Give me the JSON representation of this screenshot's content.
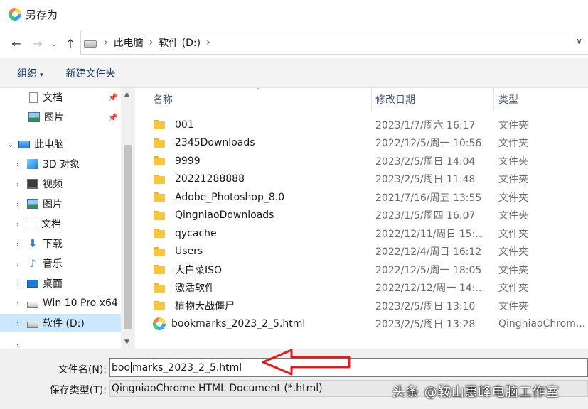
{
  "window": {
    "title": "另存为"
  },
  "address": {
    "crumbs": [
      "此电脑",
      "软件 (D:)"
    ]
  },
  "toolbar": {
    "organize": "组织",
    "new_folder": "新建文件夹"
  },
  "sidebar": {
    "items": [
      {
        "label": "文档",
        "icon": "document-icon",
        "pinned": true
      },
      {
        "label": "图片",
        "icon": "picture-icon",
        "pinned": true
      },
      {
        "label": "此电脑",
        "icon": "computer-icon",
        "expanded": true
      },
      {
        "label": "3D 对象",
        "icon": "3d-objects-icon"
      },
      {
        "label": "视频",
        "icon": "video-icon"
      },
      {
        "label": "图片",
        "icon": "picture-icon"
      },
      {
        "label": "文档",
        "icon": "document-icon"
      },
      {
        "label": "下载",
        "icon": "download-icon"
      },
      {
        "label": "音乐",
        "icon": "music-icon"
      },
      {
        "label": "桌面",
        "icon": "desktop-icon"
      },
      {
        "label": "Win 10 Pro x64",
        "icon": "windows-drive-icon"
      },
      {
        "label": "软件 (D:)",
        "icon": "drive-icon",
        "selected": true
      }
    ]
  },
  "columns": {
    "name": "名称",
    "date": "修改日期",
    "type": "类型"
  },
  "files": [
    {
      "name": "001",
      "date": "2023/1/7/周六 16:17",
      "type": "文件夹",
      "kind": "folder"
    },
    {
      "name": "2345Downloads",
      "date": "2022/12/5/周一 10:56",
      "type": "文件夹",
      "kind": "folder"
    },
    {
      "name": "9999",
      "date": "2023/2/5/周日 14:04",
      "type": "文件夹",
      "kind": "folder"
    },
    {
      "name": "20221288888",
      "date": "2023/2/5/周日 11:48",
      "type": "文件夹",
      "kind": "folder"
    },
    {
      "name": "Adobe_Photoshop_8.0",
      "date": "2021/7/16/周五 13:55",
      "type": "文件夹",
      "kind": "folder"
    },
    {
      "name": "QingniaoDownloads",
      "date": "2023/1/5/周四 16:07",
      "type": "文件夹",
      "kind": "folder"
    },
    {
      "name": "qycache",
      "date": "2022/12/11/周日 15:...",
      "type": "文件夹",
      "kind": "folder"
    },
    {
      "name": "Users",
      "date": "2022/12/4/周日 16:12",
      "type": "文件夹",
      "kind": "folder"
    },
    {
      "name": "大白菜ISO",
      "date": "2022/12/5/周一 18:05",
      "type": "文件夹",
      "kind": "folder"
    },
    {
      "name": "激活软件",
      "date": "2022/12/12/周一 14:...",
      "type": "文件夹",
      "kind": "folder"
    },
    {
      "name": "植物大战僵尸",
      "date": "2023/2/5/周日 13:10",
      "type": "文件夹",
      "kind": "folder"
    },
    {
      "name": "bookmarks_2023_2_5.html",
      "date": "2023/2/5/周日 13:28",
      "type": "QingniaoChrom...",
      "kind": "html"
    }
  ],
  "filename": {
    "label": "文件名(N):",
    "value_before_cursor": "boo",
    "value_after_cursor": "marks_2023_2_5.html"
  },
  "filetype": {
    "label": "保存类型(T):",
    "value": "QingniaoChrome HTML Document (*.html)"
  },
  "watermark": "头条 @鞍山惠峰电脑工作室",
  "colors": {
    "selection": "#cce8ff",
    "folder": "#f6c544",
    "annotation_arrow": "#e01b1b"
  }
}
